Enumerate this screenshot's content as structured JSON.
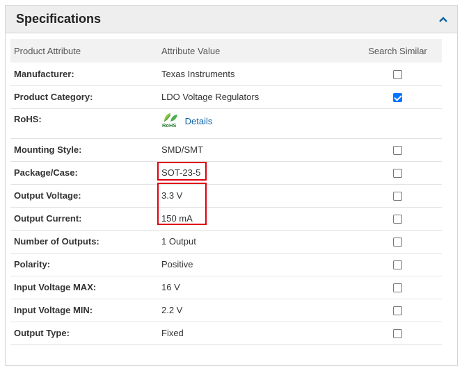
{
  "panel": {
    "title": "Specifications",
    "collapse_icon": "chevron-up-icon",
    "accent": "#0b61a4"
  },
  "table": {
    "headers": [
      "Product Attribute",
      "Attribute Value",
      "Search Similar"
    ],
    "rows": [
      {
        "attribute": "Manufacturer:",
        "value": "Texas Instruments",
        "checked": false
      },
      {
        "attribute": "Product Category:",
        "value": "LDO Voltage Regulators",
        "checked": true
      },
      {
        "attribute": "RoHS:",
        "value": "Details",
        "logo_text": "RoHS",
        "checked": null
      },
      {
        "attribute": "Mounting Style:",
        "value": "SMD/SMT",
        "checked": false
      },
      {
        "attribute": "Package/Case:",
        "value": "SOT-23-5",
        "checked": false
      },
      {
        "attribute": "Output Voltage:",
        "value": "3.3 V",
        "checked": false
      },
      {
        "attribute": "Output Current:",
        "value": "150 mA",
        "checked": false
      },
      {
        "attribute": "Number of Outputs:",
        "value": "1 Output",
        "checked": false
      },
      {
        "attribute": "Polarity:",
        "value": "Positive",
        "checked": false
      },
      {
        "attribute": "Input Voltage MAX:",
        "value": "16 V",
        "checked": false
      },
      {
        "attribute": "Input Voltage MIN:",
        "value": "2.2 V",
        "checked": false
      },
      {
        "attribute": "Output Type:",
        "value": "Fixed",
        "checked": false
      }
    ]
  },
  "highlight_color": "#e0000f"
}
